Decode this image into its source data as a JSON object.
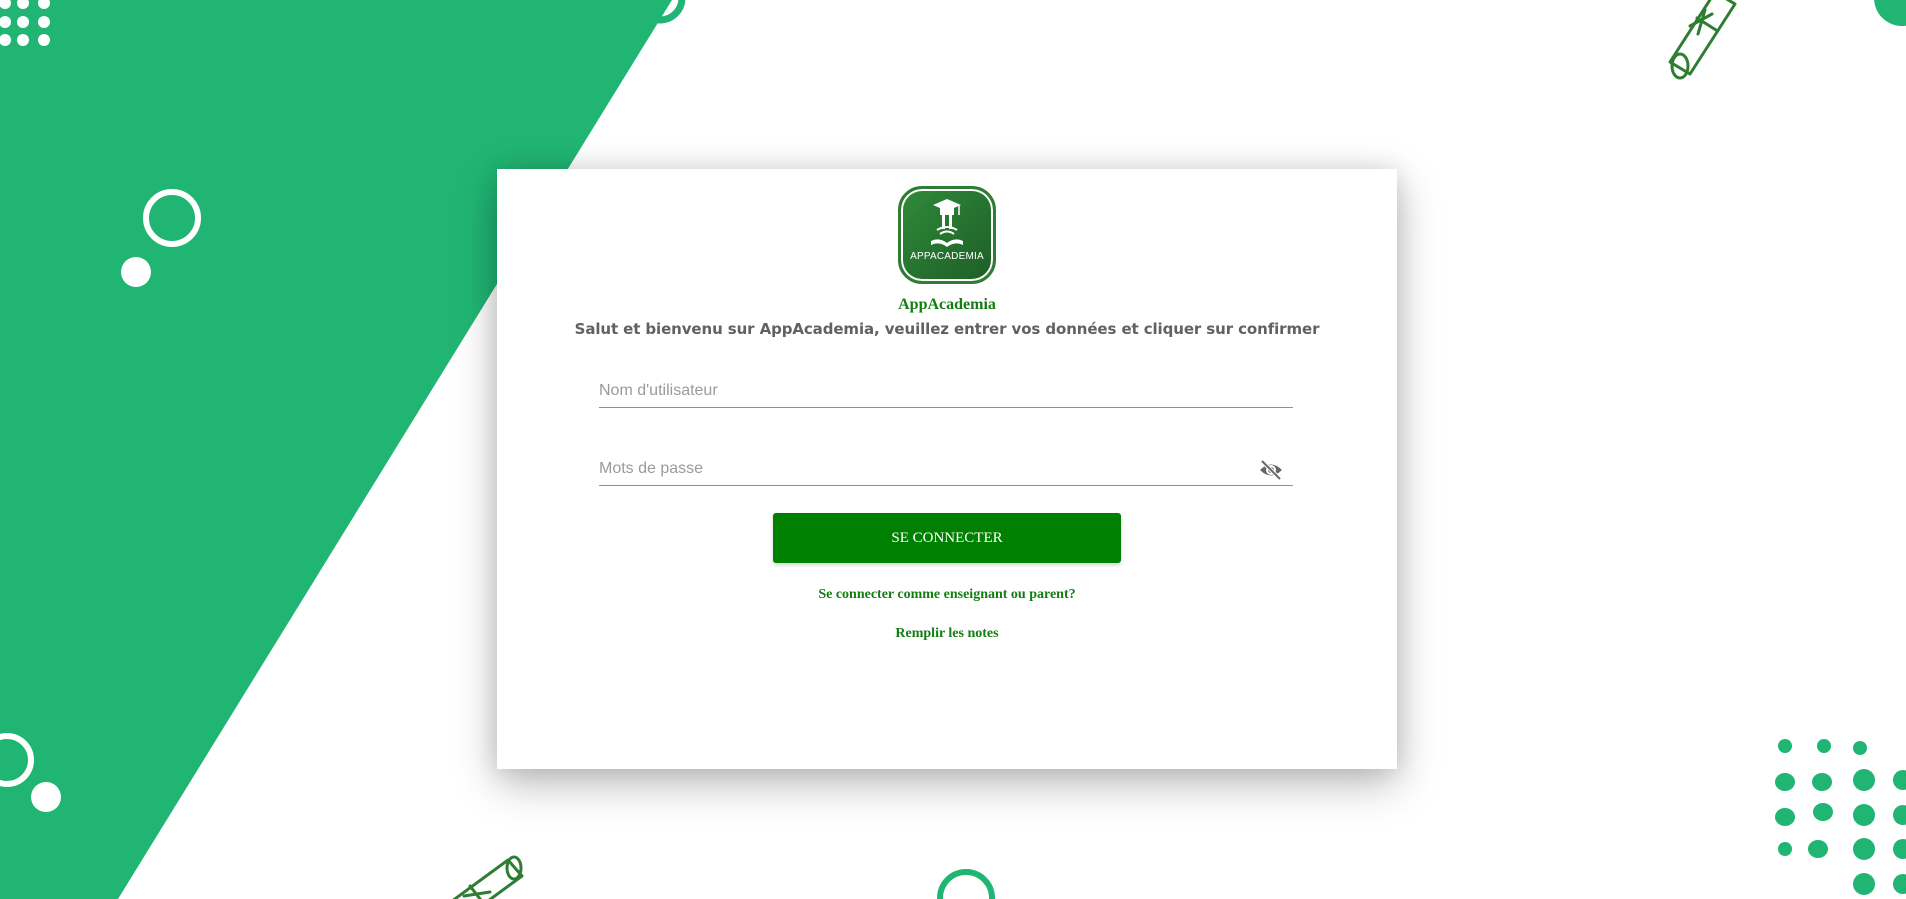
{
  "brand": {
    "name": "AppAcademia",
    "logo_text": "APPACADEMIA",
    "welcome": "Salut et bienvenu sur AppAcademia, veuillez entrer vos données et cliquer sur confirmer"
  },
  "form": {
    "username_placeholder": "Nom d'utilisateur",
    "password_placeholder": "Mots de passe",
    "submit_label": "SE CONNECTER"
  },
  "links": {
    "teacher_parent": "Se connecter comme enseignant ou parent?",
    "fill_grades": "Remplir les notes"
  },
  "icons": {
    "password_toggle": "eye-slash-icon",
    "logo": "graduation-cap-book-icon",
    "decor": "diploma-scroll-icon"
  },
  "colors": {
    "accent_green": "#21b573",
    "button_green": "#008000",
    "link_green": "#137d13",
    "text_gray": "#616161"
  }
}
